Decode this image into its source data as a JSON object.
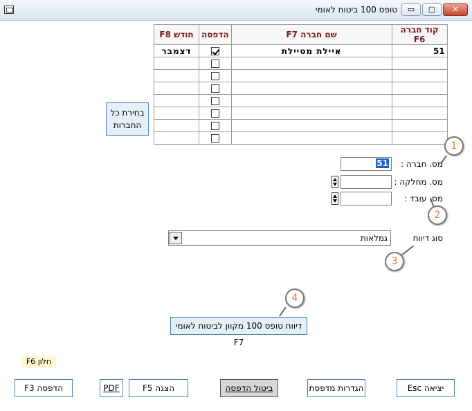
{
  "window": {
    "title": "טופס 100 ביטוח לאומי",
    "min_glyph": "▭",
    "max_glyph": "▢",
    "close_glyph": "✕"
  },
  "grid": {
    "headers": {
      "code": "קוד חברה F6",
      "name": "שם חברה F7",
      "print": "הדפסה",
      "month": "חודש F8"
    },
    "rows": [
      {
        "code": "51",
        "name": "איילת מטיילת",
        "print": true,
        "month": "דצמבר"
      },
      {
        "code": "",
        "name": "",
        "print": false,
        "month": ""
      },
      {
        "code": "",
        "name": "",
        "print": false,
        "month": ""
      },
      {
        "code": "",
        "name": "",
        "print": false,
        "month": ""
      },
      {
        "code": "",
        "name": "",
        "print": false,
        "month": ""
      },
      {
        "code": "",
        "name": "",
        "print": false,
        "month": ""
      },
      {
        "code": "",
        "name": "",
        "print": false,
        "month": ""
      },
      {
        "code": "",
        "name": "",
        "print": false,
        "month": ""
      }
    ]
  },
  "select_all": {
    "line1": "בחירת כל",
    "line2": "החברות"
  },
  "form": {
    "company_label": "מס. חברה :",
    "company_value": "51",
    "department_label": "מס. מחלקה :",
    "department_value": "",
    "employee_label": "מס. עובד :",
    "employee_value": "",
    "report_type_label": "סוג דיווח",
    "report_type_value": "גמלאות"
  },
  "callouts": [
    "1",
    "2",
    "3",
    "4"
  ],
  "online_report_button": "דיווח טופס 100 מקוון לביטוח לאומי F7",
  "help_label": "F6 חלון",
  "buttons": {
    "exit": "יציאה Esc",
    "printer_settings": "הגדרות מדפסת",
    "cancel_print": "ביטול הדפסה",
    "show": "הצגה F5",
    "pdf": "PDF",
    "print": "הדפסה F3"
  }
}
